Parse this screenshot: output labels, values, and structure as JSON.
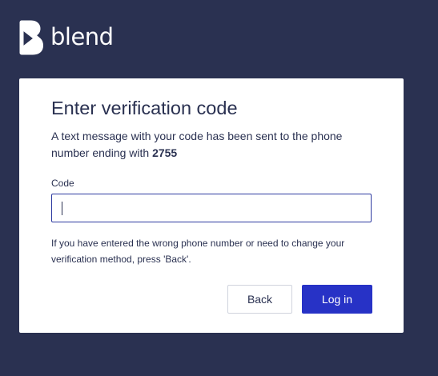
{
  "brand": {
    "name": "blend",
    "logo_icon": "blend-b-logo-icon"
  },
  "card": {
    "title": "Enter verification code",
    "message_prefix": "A text message with your code has been sent to the phone number ending with ",
    "phone_last_digits": "2755",
    "code_label": "Code",
    "code_value": "",
    "help_text": "If you have entered the wrong phone number or need to change your verification method, press 'Back'.",
    "back_label": "Back",
    "login_label": "Log in"
  },
  "colors": {
    "background": "#2a3151",
    "card": "#ffffff",
    "primary_button": "#2732c6",
    "input_border": "#2d3aa0",
    "text": "#2a3151"
  }
}
